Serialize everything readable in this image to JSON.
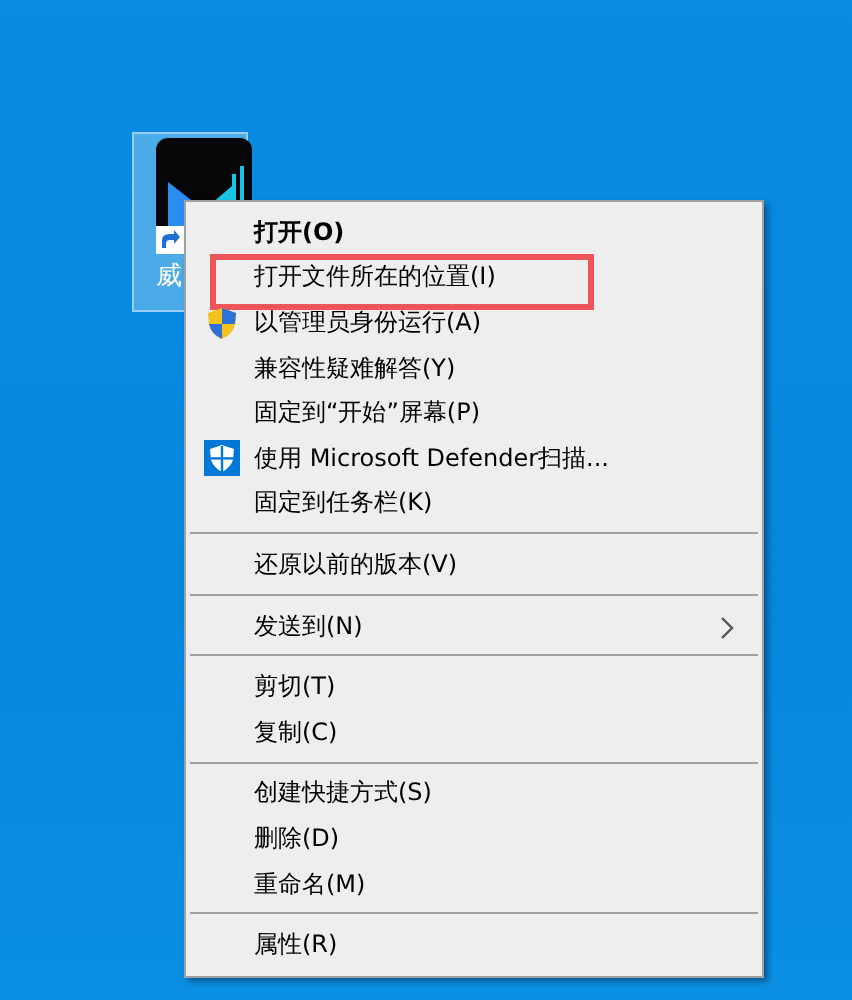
{
  "desktop_icon": {
    "label": "威",
    "selected": true
  },
  "context_menu": {
    "items": [
      {
        "kind": "default",
        "label": "打开(O)"
      },
      {
        "kind": "item",
        "label": "打开文件所在的位置(I)",
        "highlighted": true
      },
      {
        "kind": "admin",
        "label": "以管理员身份运行(A)"
      },
      {
        "kind": "item",
        "label": "兼容性疑难解答(Y)"
      },
      {
        "kind": "item",
        "label": "固定到“开始”屏幕(P)"
      },
      {
        "kind": "scan",
        "label": "使用 Microsoft Defender扫描..."
      },
      {
        "kind": "item",
        "label": "固定到任务栏(K)"
      },
      {
        "kind": "separator"
      },
      {
        "kind": "item",
        "label": "还原以前的版本(V)"
      },
      {
        "kind": "separator"
      },
      {
        "kind": "submenu",
        "label": "发送到(N)"
      },
      {
        "kind": "separator"
      },
      {
        "kind": "item",
        "label": "剪切(T)"
      },
      {
        "kind": "item",
        "label": "复制(C)"
      },
      {
        "kind": "separator"
      },
      {
        "kind": "item",
        "label": "创建快捷方式(S)"
      },
      {
        "kind": "item",
        "label": "删除(D)"
      },
      {
        "kind": "item",
        "label": "重命名(M)"
      },
      {
        "kind": "separator"
      },
      {
        "kind": "item",
        "label": "属性(R)"
      }
    ]
  }
}
